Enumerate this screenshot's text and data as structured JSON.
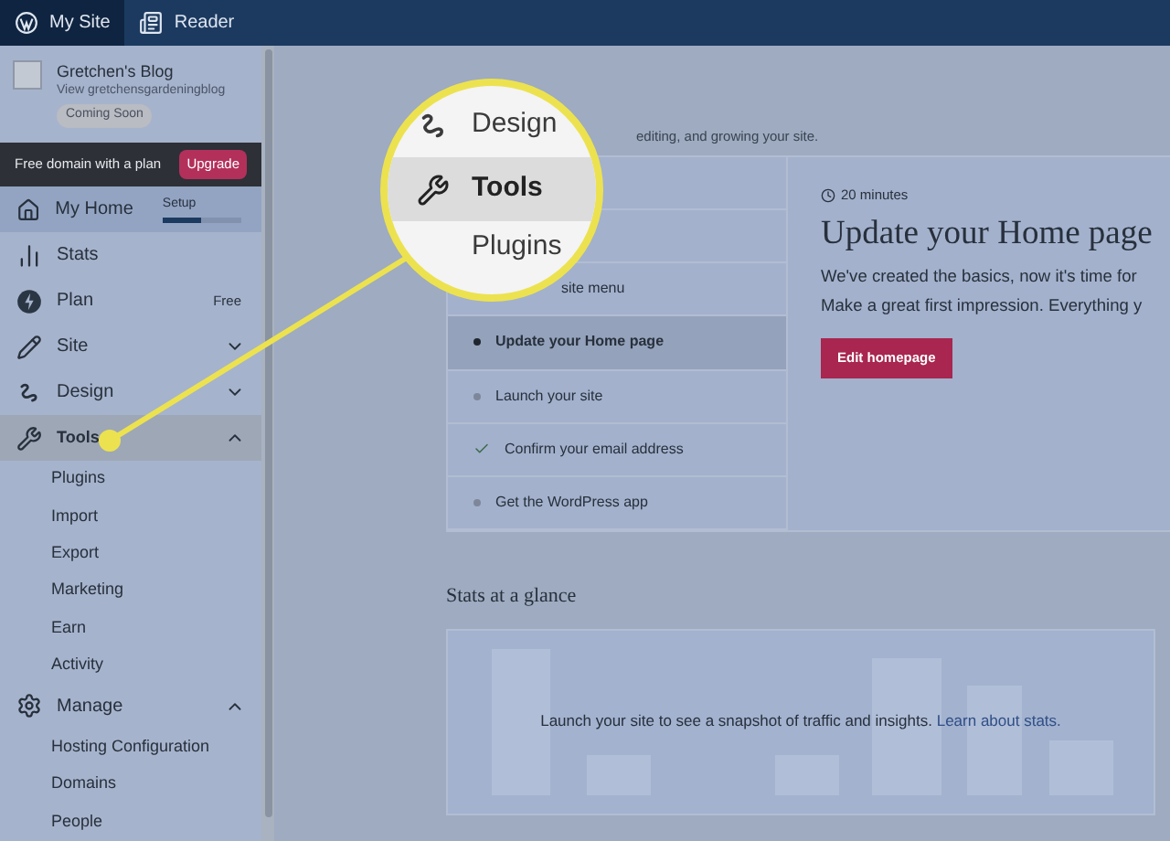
{
  "top_bar": {
    "tabs": [
      {
        "label": "My Site",
        "selected": true,
        "kind": "wordpress"
      },
      {
        "label": "Reader",
        "selected": false,
        "kind": "reader"
      }
    ]
  },
  "sidebar": {
    "site": {
      "name": "Gretchen's Blog",
      "link": "View gretchensgardeningblog",
      "badge": "Coming Soon"
    },
    "promo": {
      "text": "Free domain with a plan",
      "button": "Upgrade"
    },
    "items": [
      {
        "label": "My Home",
        "kind": "home",
        "selected": true,
        "extra": "Setup",
        "level": 0.48
      },
      {
        "label": "Stats",
        "kind": "stats",
        "selected": false
      },
      {
        "label": "Plan",
        "kind": "plan",
        "selected": false,
        "extra": "Free"
      },
      {
        "label": "Site",
        "kind": "site",
        "selected": false,
        "expanded": false
      },
      {
        "label": "Design",
        "kind": "design",
        "selected": false,
        "expanded": false
      },
      {
        "label": "Tools",
        "kind": "tools",
        "selected": true,
        "expanded": true,
        "children": [
          {
            "label": "Plugins"
          },
          {
            "label": "Import"
          },
          {
            "label": "Export"
          },
          {
            "label": "Marketing"
          },
          {
            "label": "Earn"
          },
          {
            "label": "Activity"
          }
        ]
      },
      {
        "label": "Manage",
        "kind": "manage",
        "selected": false,
        "expanded": true,
        "children": [
          {
            "label": "Hosting Configuration"
          },
          {
            "label": "Domains"
          },
          {
            "label": "People"
          }
        ]
      }
    ]
  },
  "main": {
    "subtitle": "editing, and growing your site.",
    "checklist": [
      {
        "kind": "hidden",
        "selected": false
      },
      {
        "kind": "hidden",
        "selected": false
      },
      {
        "label": "site menu",
        "kind": "hidden",
        "selected": false
      },
      {
        "label": "Update your Home page",
        "kind": "todo",
        "selected": true
      },
      {
        "label": "Launch your site",
        "kind": "todo",
        "selected": false
      },
      {
        "label": "Confirm your email address",
        "kind": "done",
        "selected": false
      },
      {
        "label": "Get the WordPress app",
        "kind": "todo",
        "selected": false
      }
    ],
    "task": {
      "time": "20 minutes",
      "title": "Update your Home page",
      "lines": [
        "We've created the basics, now it's time for",
        "Make a great first impression. Everything y"
      ],
      "button": "Edit homepage"
    },
    "stats": {
      "title": "Stats at a glance",
      "message": "Launch your site to see a snapshot of traffic and insights.",
      "link": "Learn about stats."
    }
  },
  "magnifier": {
    "items": [
      {
        "label": "Design",
        "kind": "design",
        "selected": false
      },
      {
        "label": "Tools",
        "kind": "tools",
        "selected": true
      },
      {
        "label": "Plugins",
        "kind": "plain",
        "selected": false
      }
    ]
  }
}
